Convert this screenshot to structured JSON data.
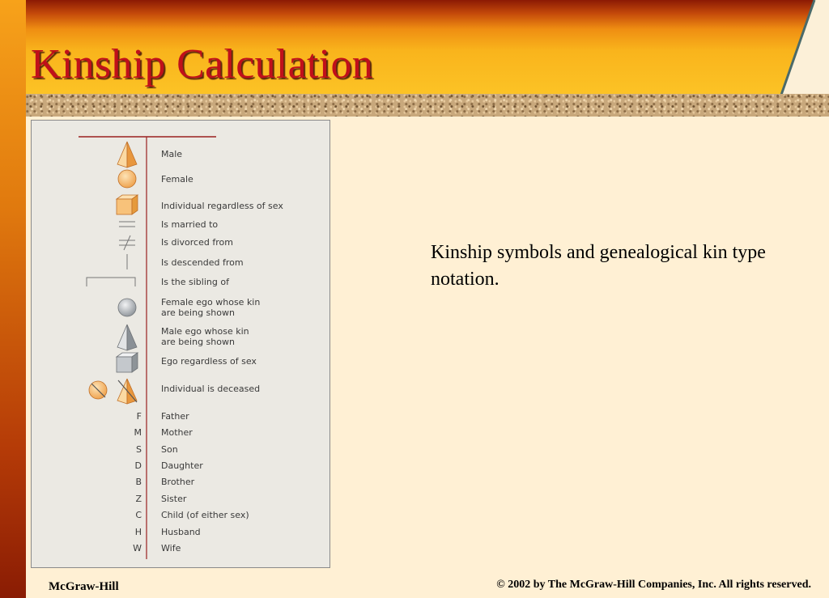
{
  "slide": {
    "title": "Kinship Calculation",
    "caption": "Kinship symbols and genealogical kin type notation.",
    "footer_left": "McGraw-Hill",
    "footer_right": "© 2002 by The McGraw-Hill Companies, Inc.  All rights reserved."
  },
  "colors": {
    "title_red": "#c0101a",
    "background": "#fff0d4",
    "symbol_orange": "#f7b865",
    "symbol_gray": "#b8bcc0",
    "rule_red": "#9a2020"
  },
  "legend": [
    {
      "symbol": "male-triangle-icon",
      "label": "Male"
    },
    {
      "symbol": "female-circle-icon",
      "label": "Female"
    },
    {
      "symbol": "individual-square-icon",
      "label": "Individual regardless of sex"
    },
    {
      "symbol": "married-equals-icon",
      "label": "Is married to"
    },
    {
      "symbol": "divorced-not-equal-icon",
      "label": "Is divorced from"
    },
    {
      "symbol": "descended-vertical-line-icon",
      "label": "Is descended from"
    },
    {
      "symbol": "sibling-bracket-icon",
      "label": "Is the sibling of"
    },
    {
      "symbol": "female-ego-circle-icon",
      "label": "Female ego whose kin\nare being shown"
    },
    {
      "symbol": "male-ego-triangle-icon",
      "label": "Male ego whose kin\nare being shown"
    },
    {
      "symbol": "ego-square-icon",
      "label": "Ego regardless of sex"
    },
    {
      "symbol": "deceased-slashed-icon",
      "label": "Individual is deceased"
    }
  ],
  "notation": [
    {
      "letter": "F",
      "label": "Father"
    },
    {
      "letter": "M",
      "label": "Mother"
    },
    {
      "letter": "S",
      "label": "Son"
    },
    {
      "letter": "D",
      "label": "Daughter"
    },
    {
      "letter": "B",
      "label": "Brother"
    },
    {
      "letter": "Z",
      "label": "Sister"
    },
    {
      "letter": "C",
      "label": "Child (of either sex)"
    },
    {
      "letter": "H",
      "label": "Husband"
    },
    {
      "letter": "W",
      "label": "Wife"
    }
  ]
}
